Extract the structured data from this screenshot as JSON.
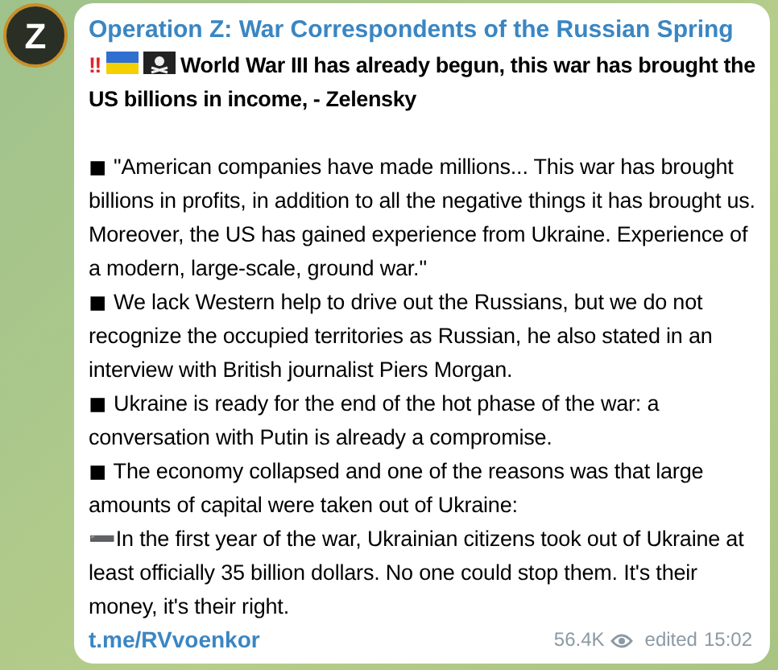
{
  "avatar": {
    "letter": "Z"
  },
  "message": {
    "channel": "Operation Z: War Correspondents of the Russian Spring",
    "headline": {
      "marks": "‼",
      "flags": [
        {
          "kind": "ukraine"
        },
        {
          "kind": "pirate"
        }
      ],
      "text": "World War III has already begun, this war has brought the US billions in income, - Zelensky"
    },
    "paragraphs": [
      "◼ \"American companies have made millions... This war has brought billions in profits, in addition to all the negative things it has brought us. Moreover, the US has gained experience from Ukraine. Experience of a modern, large-scale, ground war.\"",
      "◼ We lack Western help to drive out the Russians, but we do not recognize the occupied territories as Russian, he also stated in an interview with British journalist Piers Morgan.",
      "◼ Ukraine is ready for the end of the hot phase of the war: a conversation with Putin is already a compromise.",
      "◼ The economy collapsed and one of the reasons was that large amounts of capital were taken out of Ukraine:",
      "➖In the first year of the war, Ukrainian citizens took out of Ukraine at least officially 35 billion dollars. No one could stop them. It's their money, it's their right."
    ],
    "link": "t.me/RVvoenkor",
    "views": "56.4K",
    "edited": "edited",
    "time": "15:02"
  }
}
